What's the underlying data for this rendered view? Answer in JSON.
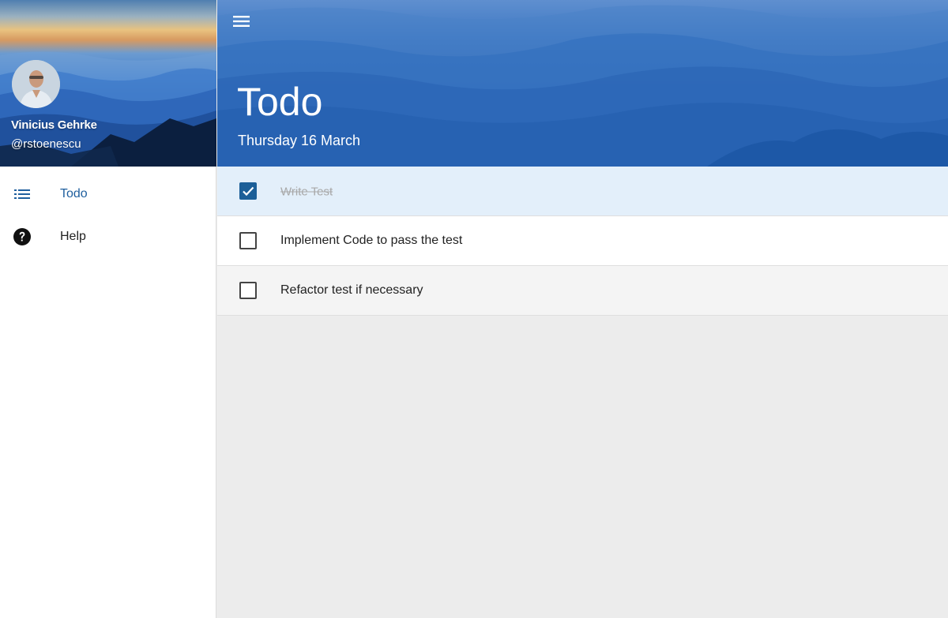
{
  "user": {
    "name": "Vinicius Gehrke",
    "handle": "@rstoenescu"
  },
  "nav": {
    "items": [
      {
        "label": "Todo",
        "icon": "list-icon",
        "active": true
      },
      {
        "label": "Help",
        "icon": "help-circle-icon",
        "active": false
      }
    ]
  },
  "header": {
    "title": "Todo",
    "date": "Thursday 16 March",
    "menu_icon": "menu-icon"
  },
  "todos": [
    {
      "text": "Write Test",
      "done": true
    },
    {
      "text": "Implement Code to pass the test",
      "done": false
    },
    {
      "text": "Refactor test if necessary",
      "done": false
    }
  ],
  "colors": {
    "accent": "#1c5f98",
    "active_nav": "#1f5f9e",
    "checked_row": "#e3effa",
    "content_bg": "#ececec"
  }
}
